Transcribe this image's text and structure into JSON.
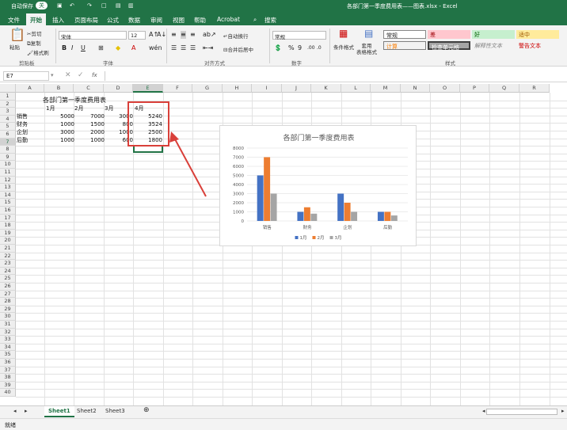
{
  "titlebar": {
    "autosave": "自动保存",
    "toggle": "关",
    "doc_title": "各部门第一季度费用表——图表.xlsx - Excel"
  },
  "menu": [
    "文件",
    "开始",
    "插入",
    "页面布局",
    "公式",
    "数据",
    "审阅",
    "视图",
    "帮助",
    "Acrobat"
  ],
  "search": "搜索",
  "ribbon": {
    "clipboard": {
      "paste": "粘贴",
      "cut": "剪切",
      "copy": "复制",
      "painter": "格式刷",
      "label": "剪贴板"
    },
    "font": {
      "name": "宋体",
      "size": "12",
      "label": "字体",
      "bold": "B",
      "italic": "I",
      "underline": "U"
    },
    "align": {
      "wrap": "自动换行",
      "merge": "合并后居中",
      "label": "对齐方式"
    },
    "number": {
      "format": "常规",
      "label": "数字"
    },
    "styles": {
      "cond": "条件格式",
      "table": "套用\n表格格式",
      "normal": "常规",
      "bad": "差",
      "good": "好",
      "neutral": "适中",
      "calc": "计算",
      "check": "检查单元格",
      "explain": "解释性文本",
      "warn": "警告文本",
      "label": "样式"
    }
  },
  "formula_bar": {
    "name_box": "E7",
    "fx": "fx",
    "content": ""
  },
  "columns": [
    "A",
    "B",
    "C",
    "D",
    "E",
    "F",
    "G",
    "H",
    "I",
    "J",
    "K",
    "L",
    "M",
    "N",
    "O",
    "P",
    "Q",
    "R"
  ],
  "sheet": {
    "title": "各部门第一季度费用表",
    "months": [
      "1月",
      "2月",
      "3月",
      "4月"
    ],
    "rows": [
      {
        "dept": "销售",
        "values": [
          5000,
          7000,
          3000,
          5240
        ]
      },
      {
        "dept": "财务",
        "values": [
          1000,
          1500,
          800,
          3524
        ]
      },
      {
        "dept": "企划",
        "values": [
          3000,
          2000,
          1000,
          2500
        ]
      },
      {
        "dept": "后勤",
        "values": [
          1000,
          1000,
          600,
          1800
        ]
      }
    ]
  },
  "chart_data": {
    "type": "bar",
    "title": "各部门第一季度费用表",
    "categories": [
      "销售",
      "财务",
      "企划",
      "后勤"
    ],
    "series": [
      {
        "name": "1月",
        "values": [
          5000,
          1000,
          3000,
          1000
        ],
        "color": "#4472c4"
      },
      {
        "name": "2月",
        "values": [
          7000,
          1500,
          2000,
          1000
        ],
        "color": "#ed7d31"
      },
      {
        "name": "3月",
        "values": [
          3000,
          800,
          1000,
          600
        ],
        "color": "#a5a5a5"
      }
    ],
    "ylim": [
      0,
      8000
    ],
    "yticks": [
      0,
      1000,
      2000,
      3000,
      4000,
      5000,
      6000,
      7000,
      8000
    ],
    "grid": true,
    "legend": "bottom"
  },
  "sheet_tabs": [
    "Sheet1",
    "Sheet2",
    "Sheet3"
  ],
  "status": "就绪",
  "colors": {
    "excel_green": "#217346",
    "annotation_red": "#d9403a"
  }
}
